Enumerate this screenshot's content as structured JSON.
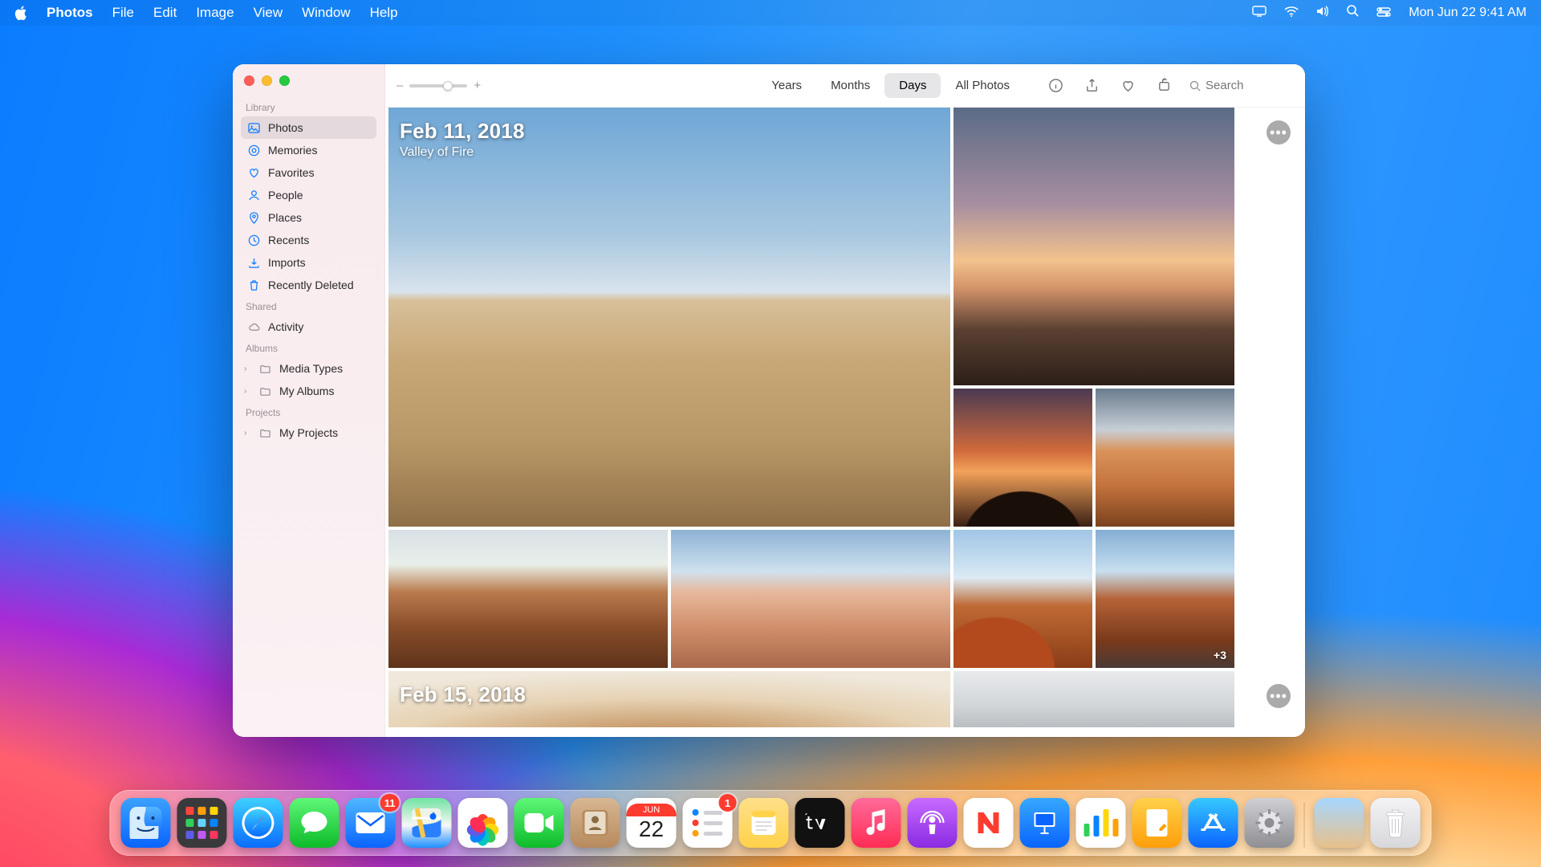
{
  "menubar": {
    "app": "Photos",
    "items": [
      "File",
      "Edit",
      "Image",
      "View",
      "Window",
      "Help"
    ],
    "datetime": "Mon Jun 22  9:41 AM"
  },
  "toolbar": {
    "zoom_minus": "–",
    "zoom_plus": "+",
    "segments": {
      "years": "Years",
      "months": "Months",
      "days": "Days",
      "all": "All Photos"
    },
    "search_placeholder": "Search"
  },
  "sidebar": {
    "sections": {
      "library": "Library",
      "shared": "Shared",
      "albums": "Albums",
      "projects": "Projects"
    },
    "library": {
      "photos": "Photos",
      "memories": "Memories",
      "favorites": "Favorites",
      "people": "People",
      "places": "Places",
      "recents": "Recents",
      "imports": "Imports",
      "recently_deleted": "Recently Deleted"
    },
    "shared": {
      "activity": "Activity"
    },
    "albums": {
      "media_types": "Media Types",
      "my_albums": "My Albums"
    },
    "projects": {
      "my_projects": "My Projects"
    }
  },
  "days": {
    "0": {
      "date": "Feb 11, 2018",
      "subtitle": "Valley of Fire",
      "overflow": "+3"
    },
    "1": {
      "date": "Feb 15, 2018"
    }
  },
  "dock": {
    "calendar": {
      "month": "JUN",
      "day": "22"
    },
    "mail_badge": "11",
    "reminders_badge": "1"
  }
}
